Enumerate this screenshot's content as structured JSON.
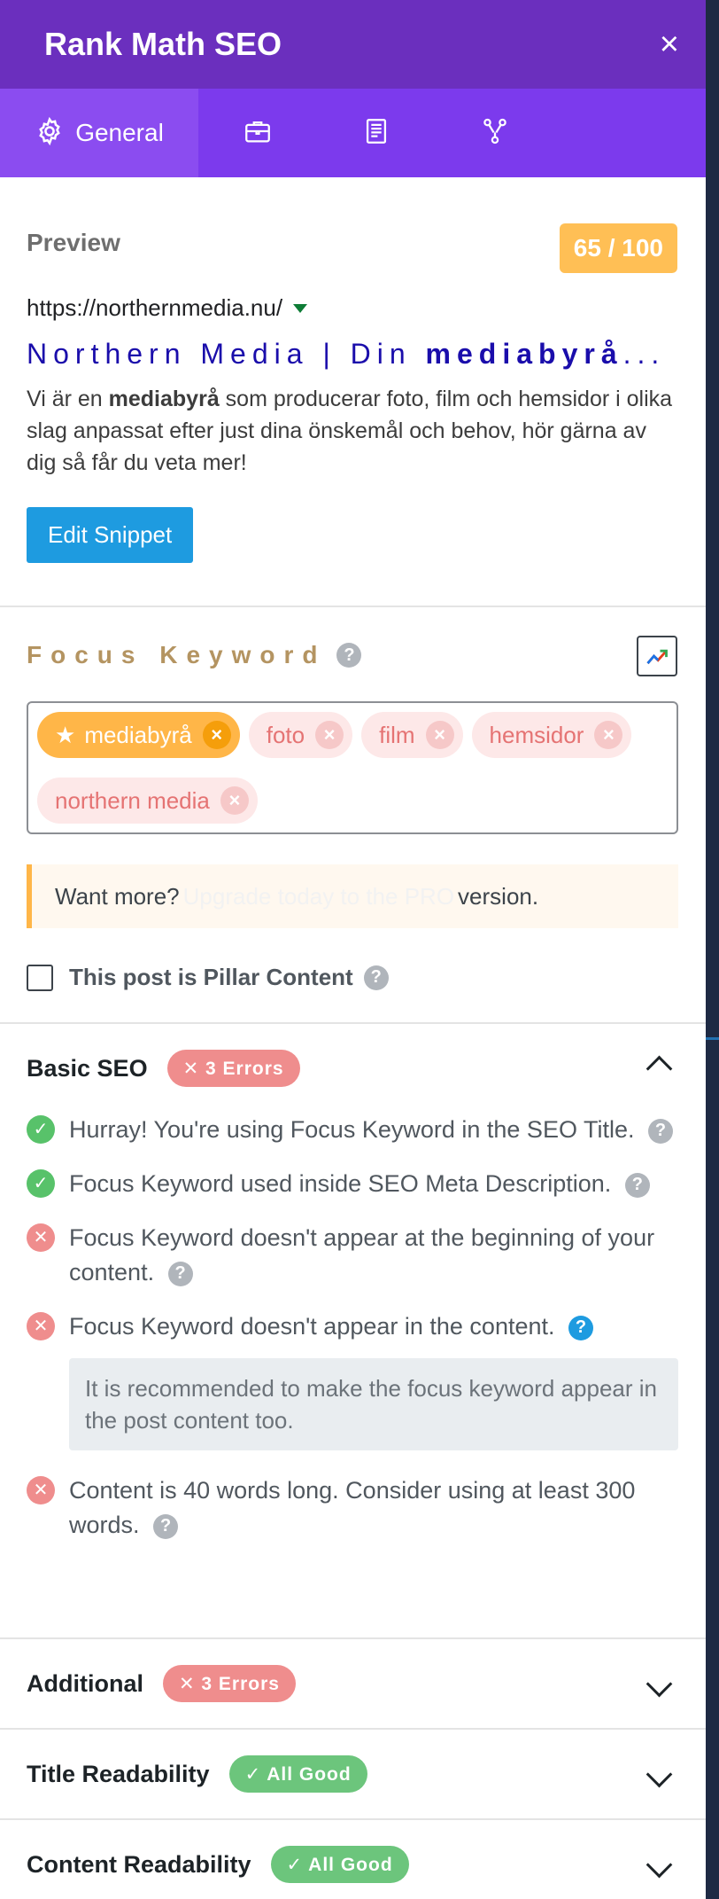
{
  "header": {
    "title": "Rank Math SEO",
    "close_icon": "×"
  },
  "tabs": [
    {
      "label": "General",
      "icon": "gear-icon",
      "active": true
    },
    {
      "label": "",
      "icon": "briefcase-icon"
    },
    {
      "label": "",
      "icon": "document-icon"
    },
    {
      "label": "",
      "icon": "schema-network-icon"
    }
  ],
  "preview": {
    "label": "Preview",
    "score": "65 / 100",
    "url": "https://northernmedia.nu/",
    "title_prefix": "Northern Media | Din ",
    "title_bold": "mediabyrå",
    "title_suffix": "...",
    "desc_prefix": "Vi är en ",
    "desc_bold": "mediabyrå",
    "desc_suffix": " som producerar foto, film och hemsidor i olika slag anpassat efter just dina önskemål och behov, hör gärna av dig så får du veta mer!",
    "edit_button": "Edit Snippet"
  },
  "focus": {
    "title": "Focus Keyword",
    "keywords": [
      {
        "text": "mediabyrå",
        "primary": true
      },
      {
        "text": "foto"
      },
      {
        "text": "film"
      },
      {
        "text": "hemsidor"
      },
      {
        "text": "northern media"
      }
    ],
    "upgrade_prefix": "Want more?",
    "upgrade_link": "Upgrade today to the PRO",
    "upgrade_suffix": "version.",
    "pillar_label": "This post is Pillar Content"
  },
  "basic_seo": {
    "title": "Basic SEO",
    "badge": "✕ 3 Errors",
    "checks": [
      {
        "status": "ok",
        "text": "Hurray! You're using Focus Keyword in the SEO Title."
      },
      {
        "status": "ok",
        "text": "Focus Keyword used inside SEO Meta Description."
      },
      {
        "status": "error",
        "text": "Focus Keyword doesn't appear at the beginning of your content."
      },
      {
        "status": "error",
        "text": "Focus Keyword doesn't appear in the content."
      },
      {
        "status": "error",
        "text": "Content is 40 words long. Consider using at least 300 words."
      }
    ],
    "tooltip": "It is recommended to make the focus keyword appear in the post content too."
  },
  "additional": {
    "title": "Additional",
    "badge": "✕ 3 Errors"
  },
  "title_readability": {
    "title": "Title Readability",
    "badge": "✓ All Good"
  },
  "content_readability": {
    "title": "Content Readability",
    "badge": "✓ All Good"
  },
  "colors": {
    "header_bg": "#6b2fbe",
    "tab_bg": "#7c3aed",
    "score_badge": "#ffbf55",
    "error": "#ef8d8d",
    "ok": "#58c26a",
    "link": "#1a0dab",
    "button": "#1e9be0"
  }
}
